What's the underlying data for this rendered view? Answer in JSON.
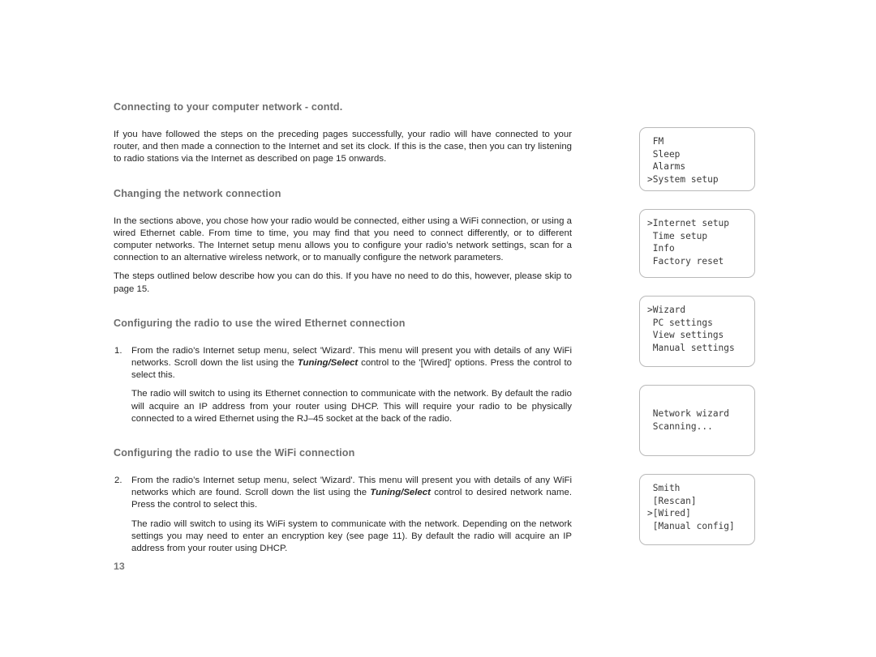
{
  "page": {
    "number": "13"
  },
  "sections": [
    {
      "heading": "Connecting to your computer network - contd.",
      "paragraphs": [
        "If you have followed the steps on the preceding pages successfully, your radio will have connected to your router, and then made a connection to the Internet and set its clock. If this is the case, then you can try listening to radio stations via the Internet as described on page 15 onwards."
      ]
    },
    {
      "heading": "Changing the network connection",
      "paragraphs": [
        "In the sections above, you chose how your radio would be connected, either using a WiFi connection, or using a wired Ethernet cable. From time to time, you may find that you need to connect differently, or to different computer networks.  The Internet setup menu allows you to configure your radio’s network settings, scan for a connection to an alternative wireless network, or to manually configure the network parameters.",
        "The steps outlined below describe how you can do this. If you have no need to do this, however, please skip to page 15."
      ]
    },
    {
      "heading": "Configuring the radio to use the wired Ethernet connection",
      "list": [
        {
          "marker": "1.",
          "text_before": "From the radio’s Internet setup menu, select 'Wizard'. This menu will present you with details of any WiFi networks. Scroll down the list using the ",
          "emphasis": "Tuning/Select",
          "text_after": " control to the '[Wired]' options. Press the control to select this."
        }
      ],
      "sub_paragraph": "The radio will switch to using its Ethernet connection to communicate with the network. By default the radio will acquire an IP address from your router using DHCP. This will require your radio to be physically connected to a wired Ethernet using the RJ–45 socket at the back of the radio."
    },
    {
      "heading": "Configuring the radio to use the WiFi connection",
      "list": [
        {
          "marker": "2.",
          "text_before": "From the radio’s Internet setup menu, select 'Wizard'. This menu will present you with details of any WiFi networks which are found. Scroll down the list using the ",
          "emphasis": "Tuning/Select",
          "text_after": " control to desired network name. Press the control to select this."
        }
      ],
      "sub_paragraph": "The radio will switch to using its WiFi system to communicate with the network. Depending on the network settings you may need to enter an encryption key (see page 11). By default the radio will acquire an IP address from your router using DHCP."
    }
  ],
  "lcd_screens": [
    {
      "id": "main-menu",
      "centered": false,
      "lines": [
        " FM",
        " Sleep",
        " Alarms",
        ">System setup"
      ]
    },
    {
      "id": "system-setup-menu",
      "centered": false,
      "lines": [
        ">Internet setup",
        " Time setup",
        " Info",
        " Factory reset"
      ]
    },
    {
      "id": "internet-setup-menu",
      "centered": false,
      "lines": [
        ">Wizard",
        " PC settings",
        " View settings",
        " Manual settings"
      ]
    },
    {
      "id": "network-wizard-scanning",
      "centered": true,
      "lines": [
        " Network wizard",
        " Scanning..."
      ]
    },
    {
      "id": "network-list",
      "centered": false,
      "lines": [
        " Smith",
        " [Rescan]",
        ">[Wired]",
        " [Manual config]"
      ]
    }
  ]
}
